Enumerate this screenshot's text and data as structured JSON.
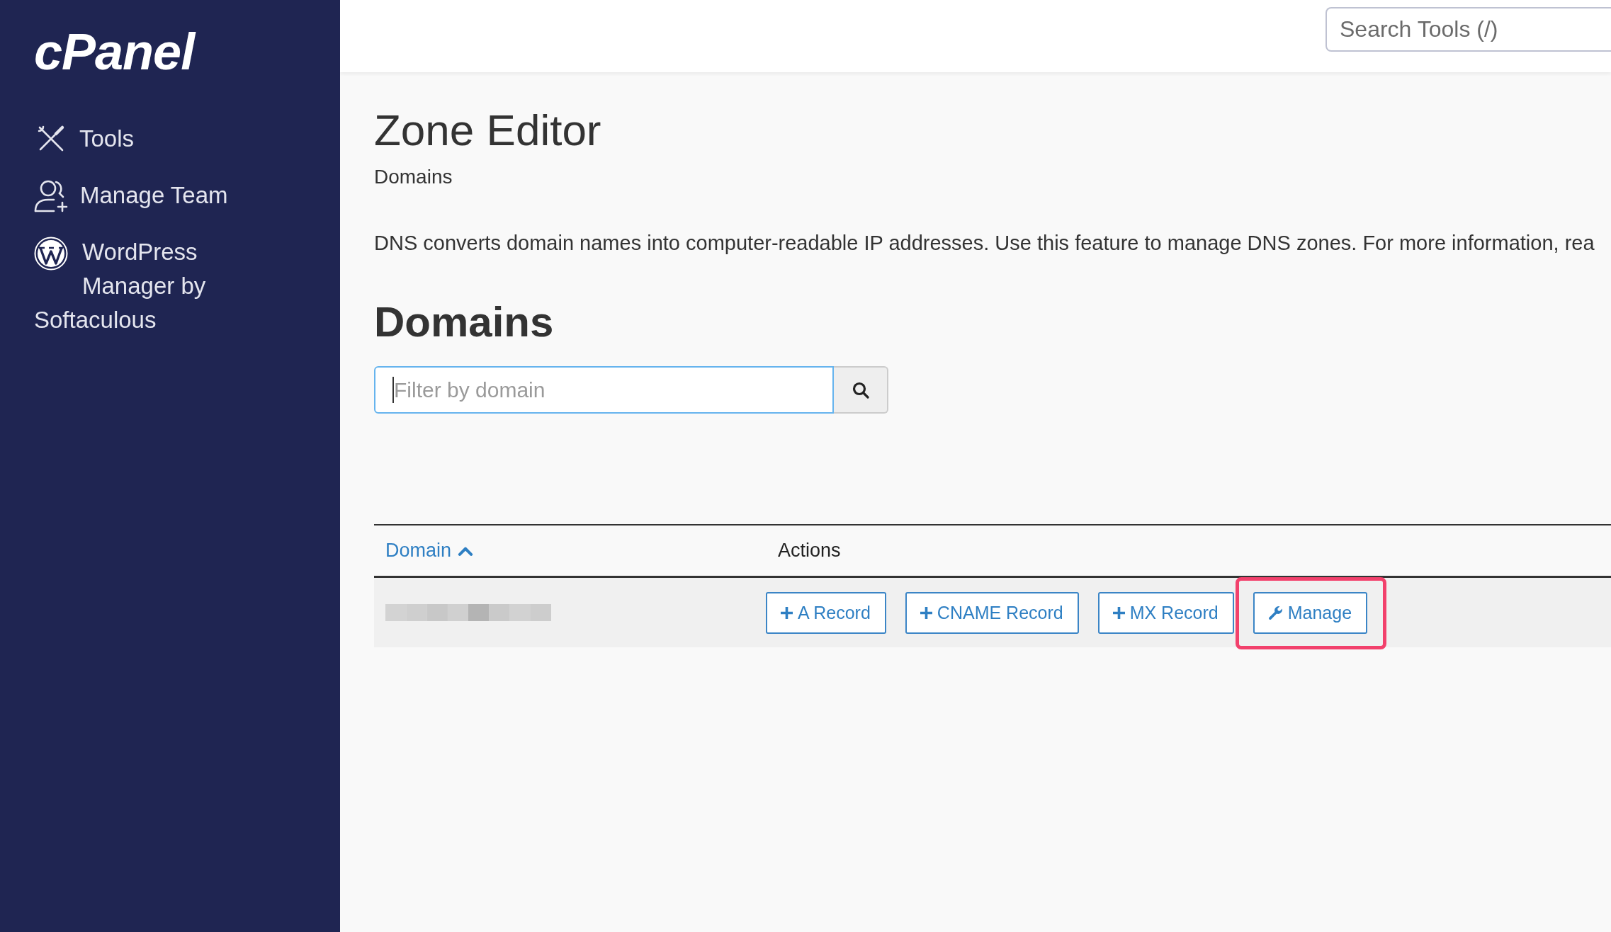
{
  "sidebar": {
    "logo": "cPanel",
    "items": [
      {
        "kind": "tools",
        "label": "Tools"
      },
      {
        "kind": "team",
        "label": "Manage Team"
      },
      {
        "kind": "wordpress",
        "label": "WordPress Manager by Softaculous"
      }
    ]
  },
  "topbar": {
    "search": {
      "placeholder": "Search Tools (/)"
    }
  },
  "page": {
    "title": "Zone Editor",
    "breadcrumb": "Domains",
    "description": "DNS converts domain names into computer-readable IP addresses. Use this feature to manage DNS zones. For more information, rea"
  },
  "domains": {
    "heading": "Domains",
    "filter": {
      "placeholder": "Filter by domain",
      "focused": true
    },
    "table": {
      "columns": [
        {
          "label": "Domain",
          "sortable": true,
          "sorted": true
        },
        {
          "label": "Actions",
          "sortable": false,
          "sorted": false
        }
      ],
      "rows": [
        {
          "actions": [
            {
              "kind": "add",
              "label": "A Record",
              "highlighted": false
            },
            {
              "kind": "add",
              "label": "CNAME Record",
              "highlighted": false
            },
            {
              "kind": "add",
              "label": "MX Record",
              "highlighted": false
            },
            {
              "kind": "manage",
              "label": "Manage",
              "highlighted": true
            }
          ]
        }
      ]
    }
  }
}
